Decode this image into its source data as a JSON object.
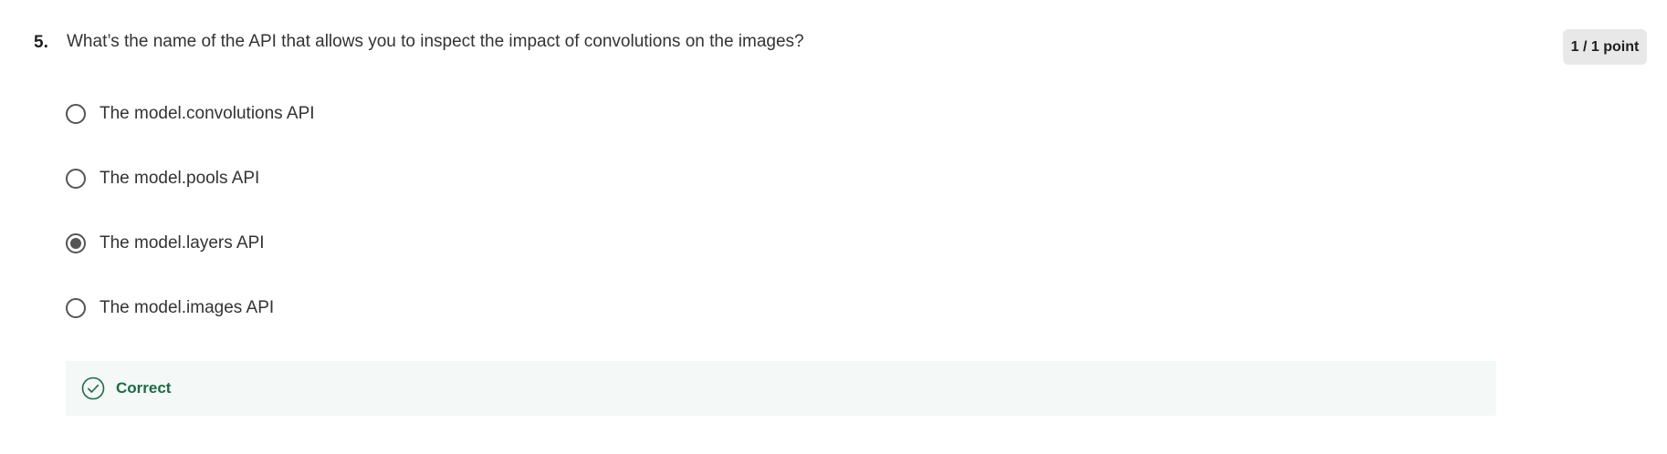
{
  "question": {
    "number": "5.",
    "text": "What’s the name of the API that allows you to inspect the impact of convolutions on the images?",
    "points": "1 / 1 point"
  },
  "options": [
    {
      "label": "The model.convolutions API",
      "selected": false
    },
    {
      "label": "The model.pools API",
      "selected": false
    },
    {
      "label": "The model.layers API",
      "selected": true
    },
    {
      "label": "The model.images API",
      "selected": false
    }
  ],
  "feedback": {
    "status": "Correct",
    "icon": "check-circle-icon",
    "color": "#1d6b45",
    "background": "#f4f8f6"
  }
}
